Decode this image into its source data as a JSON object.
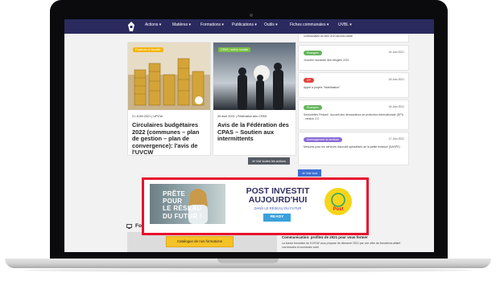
{
  "nav": {
    "items": [
      "Actions ▾",
      "Matières ▾",
      "Formations ▾",
      "Publications ▾",
      "Outils ▾",
      "Fiches communales ▾",
      "UVBL ▾"
    ]
  },
  "top_snippet": "communales au sein d'un accord-cadre",
  "cards": [
    {
      "tag": "Finances et fiscalité",
      "meta": "21 JUIN 2021 | UPCW",
      "title": "Circulaires budgétaires 2022 (communes – plan de gestion – plan de convergence): l'avis de l'UVCW",
      "tag_color": "#f5b400"
    },
    {
      "tag": "CPAS / action sociale",
      "meta": "30 avril 2021 | Fédération des CPAS",
      "title": "Avis de la Fédération des CPAS – Soutien aux intermittents",
      "tag_color": "#7bc043"
    }
  ],
  "news": [
    {
      "badge": "Étrangers",
      "date": "18 Juin 2021",
      "text": "Journée mondiale des réfugiés 2021",
      "color": "#63b55a"
    },
    {
      "badge": "CP",
      "date": "18 Juin 2021",
      "text": "Appel à projets \"Mobilisation\"",
      "color": "#e0443c"
    },
    {
      "badge": "Étrangers",
      "date": "18 Juin 2021",
      "text": "Sectorielles Fedasil : Accueil des demandeurs de protection internationale (DPI) : version 2.0",
      "color": "#63b55a"
    },
    {
      "badge": "Aménagement du territoire",
      "date": "17 Juin 2021",
      "text": "Mesures pour les services d'accueil spécialisés de la petite enfance (SASPE)",
      "color": "#8b6bd6"
    }
  ],
  "buttons": {
    "all_actions": "≫ Voir toutes les actions",
    "all_news": "≫ Voir tout"
  },
  "ad": {
    "left_text": [
      "PRÊTE",
      "POUR",
      "LE RÉSEAU",
      "DU FUTUR !"
    ],
    "headline_1": "POST INVESTIT",
    "headline_2": "AUJOURD'HUI",
    "subline": "DANS LE RÉSEAU DU FUTUR",
    "cta": "READY",
    "logo_text": "Post",
    "highlight_color": "#e8112d"
  },
  "formations": {
    "title": "Formations",
    "catalogue_button": "Catalogue de nos formations",
    "comm_title": "Communication: profitez de 2021 pour vous former",
    "comm_text": "La bonne formation de l'UVCW vous propose de démarrer 2021 par une offre de formations alliant vos besoins et construire votre"
  }
}
